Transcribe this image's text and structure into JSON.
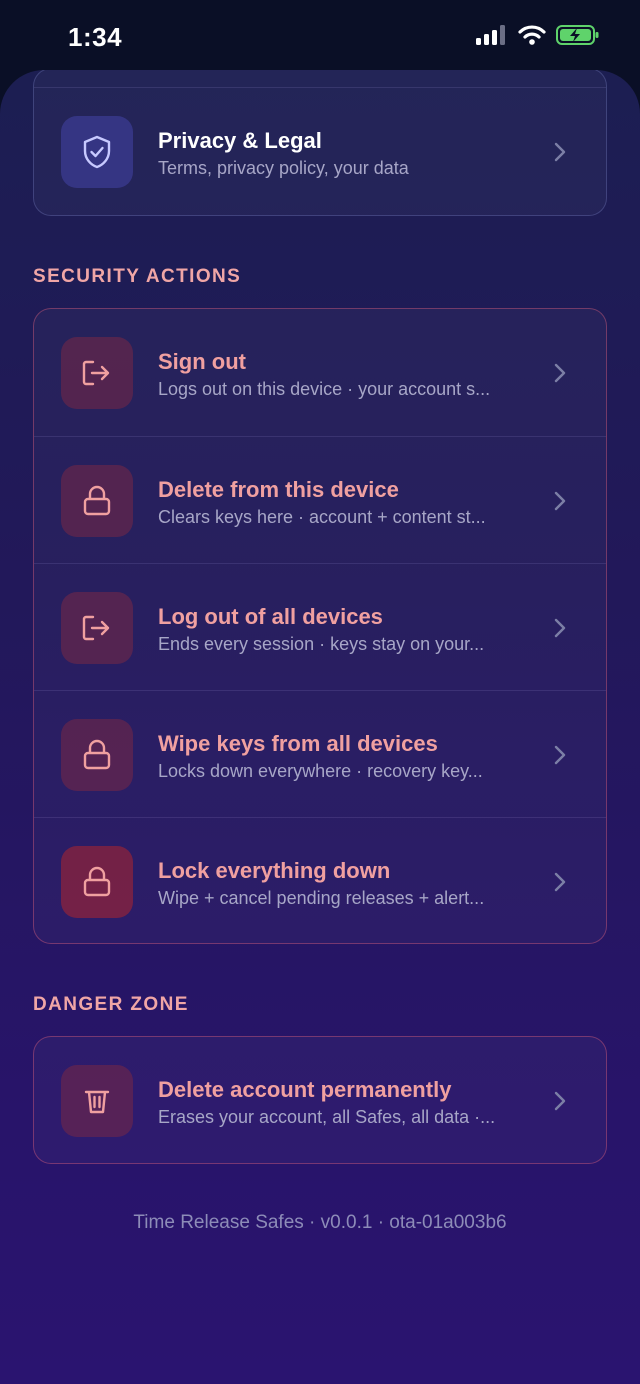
{
  "status_bar": {
    "time": "1:34"
  },
  "top_section": {
    "items": [
      {
        "title": "Privacy & Legal",
        "subtitle": "Terms, privacy policy, your data",
        "icon": "shield-check-icon"
      }
    ]
  },
  "security_actions": {
    "label": "SECURITY ACTIONS",
    "items": [
      {
        "title": "Sign out",
        "subtitle": "Logs out on this device · your account s...",
        "icon": "sign-out-icon"
      },
      {
        "title": "Delete from this device",
        "subtitle": "Clears keys here · account + content st...",
        "icon": "lock-icon"
      },
      {
        "title": "Log out of all devices",
        "subtitle": "Ends every session · keys stay on your...",
        "icon": "sign-out-icon"
      },
      {
        "title": "Wipe keys from all devices",
        "subtitle": "Locks down everywhere · recovery key...",
        "icon": "lock-icon"
      },
      {
        "title": "Lock everything down",
        "subtitle": "Wipe + cancel pending releases + alert...",
        "icon": "lock-icon"
      }
    ]
  },
  "danger_zone": {
    "label": "DANGER ZONE",
    "items": [
      {
        "title": "Delete account permanently",
        "subtitle": "Erases your account, all Safes, all data ·...",
        "icon": "trash-icon"
      }
    ]
  },
  "footer": {
    "version_text": "Time Release Safes · v0.0.1 · ota-01a003b6"
  },
  "colors": {
    "accent_rose": "#f0a0a0",
    "accent_violet": "#353583",
    "text_secondary": "#a7a6c7"
  }
}
